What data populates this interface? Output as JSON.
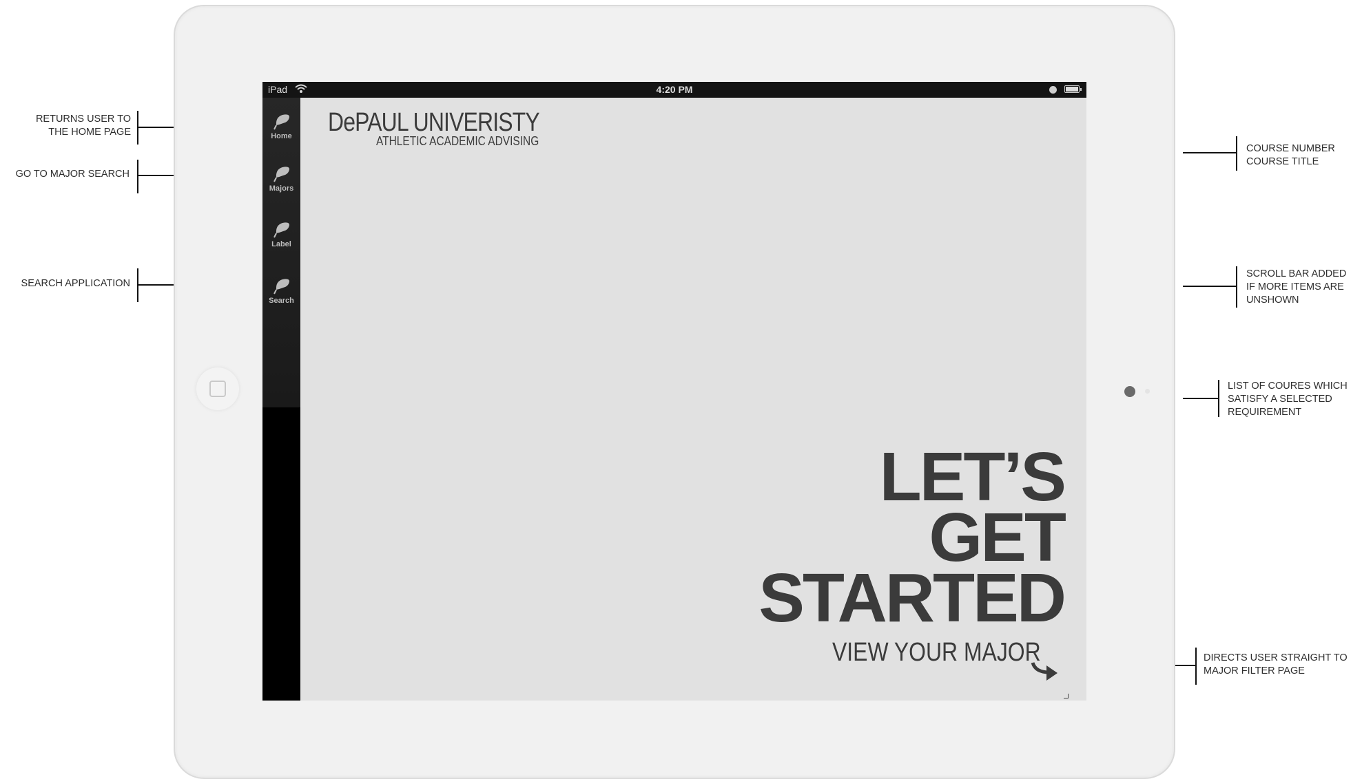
{
  "device": {
    "name": "iPad",
    "time": "4:20 PM"
  },
  "sidebar": {
    "items": [
      {
        "label": "Home"
      },
      {
        "label": "Majors"
      },
      {
        "label": "Label"
      },
      {
        "label": "Search"
      }
    ]
  },
  "brand": {
    "title": "DePAUL UNIVERISTY",
    "subtitle": "ATHLETIC ACADEMIC ADVISING"
  },
  "hero": {
    "line1": "LET’S",
    "line2": "GET",
    "line3": "STARTED",
    "cta": "VIEW YOUR MAJOR"
  },
  "annotations": {
    "home": [
      "RETURNS USER TO",
      "THE HOME PAGE"
    ],
    "majors": [
      "GO TO MAJOR SEARCH"
    ],
    "search": [
      "SEARCH APPLICATION"
    ],
    "course": [
      "COURSE NUMBER",
      "COURSE TITLE"
    ],
    "scroll": [
      "SCROLL BAR ADDED",
      "IF MORE ITEMS ARE",
      "UNSHOWN"
    ],
    "list": [
      "LIST OF COURES WHICH",
      "SATISFY A SELECTED",
      "REQUIREMENT"
    ],
    "directs": [
      "DIRECTS USER STRAIGHT TO",
      "MAJOR FILTER PAGE"
    ]
  },
  "colors": {
    "bezel": "#f1f1f1",
    "screen": "#e1e1e1",
    "sidebar": "#000000",
    "text_dark": "#3b3b3b"
  }
}
